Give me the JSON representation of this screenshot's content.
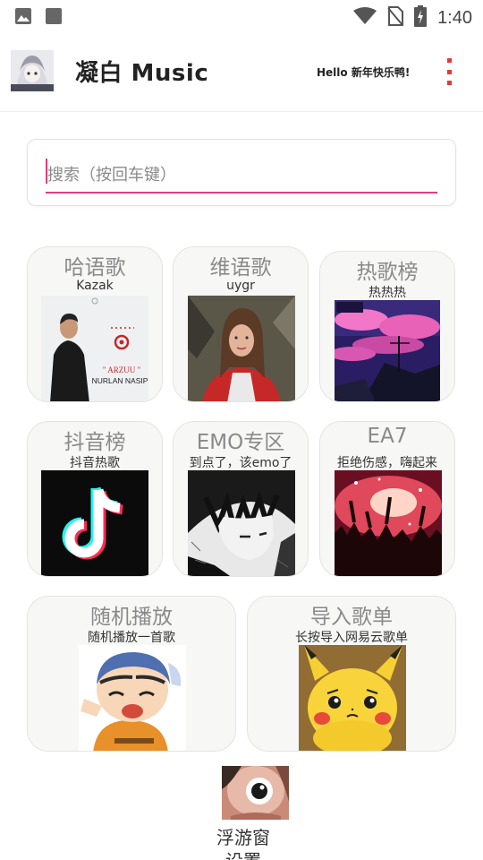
{
  "status_bar": {
    "time": "1:40",
    "icons": [
      "image-icon",
      "square-icon",
      "wifi-icon",
      "no-sim-icon",
      "battery-icon"
    ]
  },
  "header": {
    "title": "凝白 Music",
    "greeting": "Hello 新年快乐鸭!",
    "menu_icon": "more-vertical-icon",
    "accent_color": "#e53935"
  },
  "search": {
    "placeholder": "搜索（按回车键）",
    "value": "",
    "underline_color": "#e43c80"
  },
  "cards": [
    {
      "title": "哈语歌",
      "subtitle": "Kazak",
      "image": "album-cover-arzuu"
    },
    {
      "title": "维语歌",
      "subtitle": "uygr",
      "image": "woman-portrait-photo"
    },
    {
      "title": "热歌榜",
      "subtitle": "热热热",
      "image": "pink-sky-rooftop-art"
    },
    {
      "title": "抖音榜",
      "subtitle": "抖音热歌",
      "image": "tiktok-logo"
    },
    {
      "title": "EMO专区",
      "subtitle": "到点了，该emo了",
      "image": "manga-boy-art"
    },
    {
      "title": "EA7",
      "subtitle": "拒绝伤感，嗨起来",
      "image": "concert-crowd-photo"
    },
    {
      "title": "随机播放",
      "subtitle": "随机播放一首歌",
      "image": "crayon-shinchan-image"
    },
    {
      "title": "导入歌单",
      "subtitle": "长按导入网易云歌单",
      "image": "sad-pikachu-image"
    }
  ],
  "album_text": {
    "arzuu": "\" ARZUU \"",
    "artist": "NURLAN NASIP"
  },
  "floating": {
    "label": "浮游窗设置"
  }
}
